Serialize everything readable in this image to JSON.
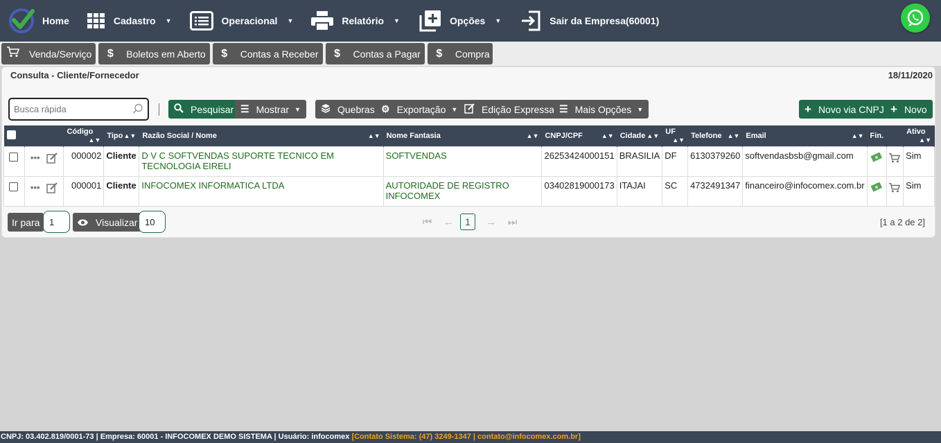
{
  "nav": {
    "home": "Home",
    "cadastro": "Cadastro",
    "operacional": "Operacional",
    "relatorio": "Relatório",
    "opcoes": "Opções",
    "sair": "Sair da Empresa(60001)"
  },
  "shortcuts": [
    "Venda/Serviço",
    "Boletos em Aberto",
    "Contas a Receber",
    "Contas a Pagar",
    "Compra"
  ],
  "page": {
    "title": "Consulta - Cliente/Fornecedor",
    "date": "18/11/2020"
  },
  "toolbar": {
    "search_placeholder": "Busca rápida",
    "pesquisar": "Pesquisar",
    "mostrar": "Mostrar",
    "quebras": "Quebras",
    "exportacao": "Exportação",
    "edicao": "Edição Expressa",
    "mais": "Mais Opções",
    "novo_cnpj": "Novo via CNPJ",
    "novo": "Novo"
  },
  "table": {
    "headers": [
      "Código",
      "Tipo",
      "Razão Social / Nome",
      "Nome Fantasia",
      "CNPJ/CPF",
      "Cidade",
      "UF",
      "Telefone",
      "Email",
      "Fin.",
      "Ativo"
    ],
    "rows": [
      {
        "codigo": "000002",
        "tipo": "Cliente",
        "razao": "D V C SOFTVENDAS SUPORTE TECNICO EM TECNOLOGIA EIRELI",
        "fantasia": "SOFTVENDAS",
        "cnpj": "26253424000151",
        "cidade": "BRASILIA",
        "uf": "DF",
        "telefone": "6130379260",
        "email": "softvendasbsb@gmail.com",
        "ativo": "Sim"
      },
      {
        "codigo": "000001",
        "tipo": "Cliente",
        "razao": "INFOCOMEX INFORMATICA LTDA",
        "fantasia": "AUTORIDADE DE REGISTRO INFOCOMEX",
        "cnpj": "03402819000173",
        "cidade": "ITAJAI",
        "uf": "SC",
        "telefone": "4732491347",
        "email": "financeiro@infocomex.com.br",
        "ativo": "Sim"
      }
    ]
  },
  "pagination": {
    "ir_para": "Ir para",
    "page_value": "1",
    "visualizar": "Visualizar",
    "per_page": "10",
    "current": "1",
    "summary": "[1 a 2 de 2]"
  },
  "footer": {
    "info": "CNPJ: 03.402.819/0001-73 | Empresa: 60001 - INFOCOMEX DEMO SISTEMA | Usuário: infocomex ",
    "contact": "[Contato Sistema: (47) 3249-1347 | contato@infocomex.com.br]"
  },
  "colors": {
    "nav_bg": "#3b4656",
    "green_btn": "#1f6b4a",
    "gray_btn": "#585858",
    "link_green": "#1e6b1e",
    "whatsapp": "#2fce46",
    "footer_contact": "#f0a11e"
  }
}
